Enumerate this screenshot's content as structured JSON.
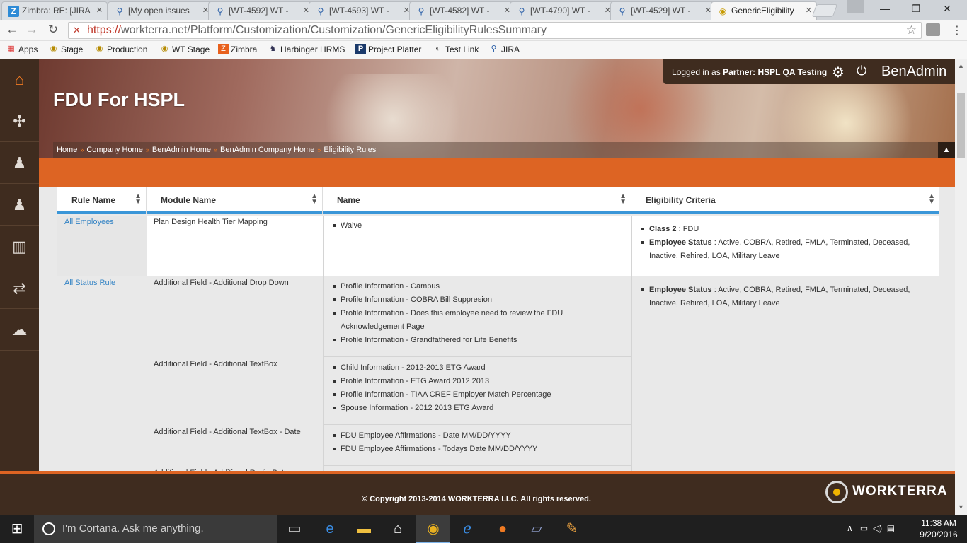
{
  "browser": {
    "tabs": [
      {
        "label": "Zimbra: RE: [JIRA",
        "icon": "zimbra-icon"
      },
      {
        "label": "[My open issues",
        "icon": "jira-icon"
      },
      {
        "label": "[WT-4592] WT -",
        "icon": "jira-icon"
      },
      {
        "label": "[WT-4593] WT -",
        "icon": "jira-icon"
      },
      {
        "label": "[WT-4582] WT -",
        "icon": "jira-icon"
      },
      {
        "label": "[WT-4790] WT -",
        "icon": "jira-icon"
      },
      {
        "label": "[WT-4529] WT -",
        "icon": "jira-icon"
      },
      {
        "label": "GenericEligibility",
        "icon": "workterra-icon",
        "active": true
      }
    ],
    "url_scheme": "https://",
    "url_rest": "workterra.net/Platform/Customization/Customization/GenericEligibilityRulesSummary",
    "bookmarks": [
      "Apps",
      "Stage",
      "Production",
      "WT Stage",
      "Zimbra",
      "Harbinger HRMS",
      "Project Platter",
      "Test Link",
      "JIRA"
    ]
  },
  "header": {
    "title": "FDU For HSPL",
    "login_prefix": "Logged in as",
    "login_role": "Partner:",
    "login_name": "HSPL QA Testing",
    "brand": "BenAdmin",
    "breadcrumbs": [
      "Home",
      "Company Home",
      "BenAdmin Home",
      "BenAdmin Company Home",
      "Eligibility Rules"
    ]
  },
  "table": {
    "columns": [
      "Rule Name",
      "Module Name",
      "Name",
      "Eligibility Criteria"
    ],
    "rows": [
      {
        "rule": "All Employees",
        "module": "Plan Design Health Tier Mapping",
        "names": [
          "Waive"
        ],
        "criteria": [
          {
            "label": "Class 2",
            "value": "FDU"
          },
          {
            "label": "Employee Status",
            "value": "Active, COBRA, Retired, FMLA, Terminated, Deceased, Inactive, Rehired, LOA, Military Leave"
          }
        ]
      },
      {
        "rule": "All Status Rule",
        "groups": [
          {
            "module": "Additional Field - Additional Drop Down",
            "names": [
              "Profile Information - Campus",
              "Profile Information - COBRA Bill Suppresion",
              "Profile Information - Does this employee need to review the FDU Acknowledgement Page",
              "Profile Information - Grandfathered for Life Benefits"
            ]
          },
          {
            "module": "Additional Field - Additional TextBox",
            "names": [
              "Child Information - 2012-2013 ETG Award",
              "Profile Information - ETG Award 2012 2013",
              "Profile Information - TIAA CREF Employer Match Percentage",
              "Spouse Information - 2012 2013 ETG Award"
            ]
          },
          {
            "module": "Additional Field - Additional TextBox - Date",
            "names": [
              "FDU Employee Affirmations - Date MM/DD/YYYY",
              "FDU Employee Affirmations - Todays Date MM/DD/YYYY"
            ]
          },
          {
            "module": "Additional Field - Additional Radio Button",
            "names": []
          }
        ],
        "criteria": [
          {
            "label": "Employee Status",
            "value": "Active, COBRA, Retired, FMLA, Terminated, Deceased, Inactive, Rehired, LOA, Military Leave"
          }
        ]
      }
    ]
  },
  "footer": {
    "copyright": "© Copyright 2013-2014 WORKTERRA LLC. All rights reserved.",
    "logo_text": "WORKTERRA"
  },
  "taskbar": {
    "search_placeholder": "I'm Cortana. Ask me anything.",
    "time": "11:38 AM",
    "date": "9/20/2016"
  },
  "colors": {
    "accent": "#dd6423",
    "nav_bg": "#3f2c1f",
    "link": "#3383c4",
    "header_rule": "#3a96d8"
  }
}
